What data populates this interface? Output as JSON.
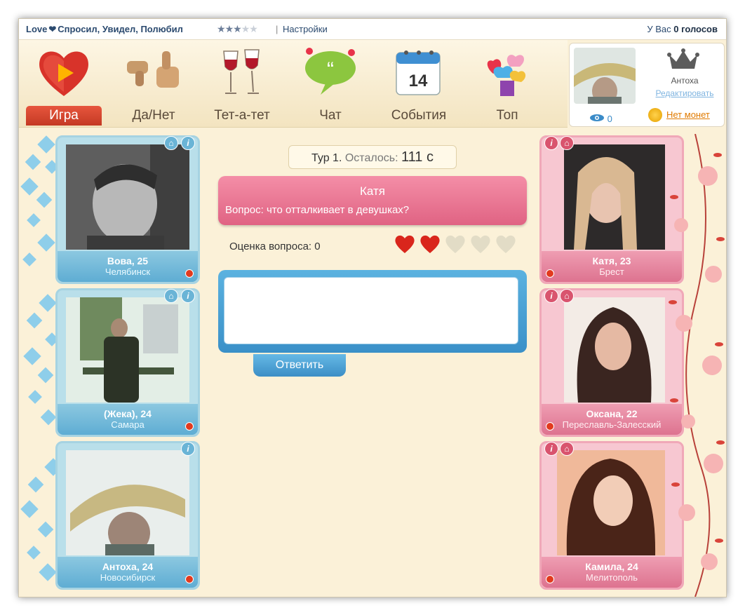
{
  "topbar": {
    "title_part1": "Love",
    "title_part2": "Спросил, Увидел, Полюбил",
    "rating_stars": 3,
    "rating_max": 5,
    "separator": "|",
    "settings_label": "Настройки",
    "votes_prefix": "У Вас",
    "votes_value": "0 голосов"
  },
  "nav": {
    "items": [
      {
        "label": "Игра",
        "icon": "heart-play-icon",
        "active": true
      },
      {
        "label": "Да/Нет",
        "icon": "thumbs-icon",
        "active": false
      },
      {
        "label": "Тет-а-тет",
        "icon": "wine-glasses-icon",
        "active": false
      },
      {
        "label": "Чат",
        "icon": "chat-bubble-icon",
        "active": false
      },
      {
        "label": "События",
        "icon": "calendar-icon",
        "active": false
      },
      {
        "label": "Топ",
        "icon": "gift-hearts-icon",
        "active": false
      }
    ],
    "calendar_day": "14"
  },
  "profile": {
    "views": "0",
    "name": "Антоха",
    "edit_label": "Редактировать",
    "coins_label": "Нет монет"
  },
  "left_cards": [
    {
      "name": "Вова, 25",
      "city": "Челябинск",
      "has_gift": true
    },
    {
      "name": "(Жека), 24",
      "city": "Самара",
      "has_gift": true
    },
    {
      "name": "Антоха, 24",
      "city": "Новосибирск",
      "has_gift": false
    }
  ],
  "right_cards": [
    {
      "name": "Катя, 23",
      "city": "Брест"
    },
    {
      "name": "Оксана, 22",
      "city": "Переславль-Залесский"
    },
    {
      "name": "Камила, 24",
      "city": "Мелитополь"
    }
  ],
  "game": {
    "round_label": "Тур 1.",
    "remaining_label": "Осталось:",
    "seconds": "111 с",
    "question_author": "Катя",
    "question_text": "Вопрос: что отталкивает в девушках?",
    "rating_label": "Оценка вопроса: 0",
    "hearts_filled": 2,
    "hearts_total": 5,
    "reply_label": "Ответить"
  },
  "colors": {
    "accent_red": "#d9442b",
    "accent_blue": "#3a90c8",
    "accent_pink": "#e06383",
    "background": "#fbf1d8"
  }
}
